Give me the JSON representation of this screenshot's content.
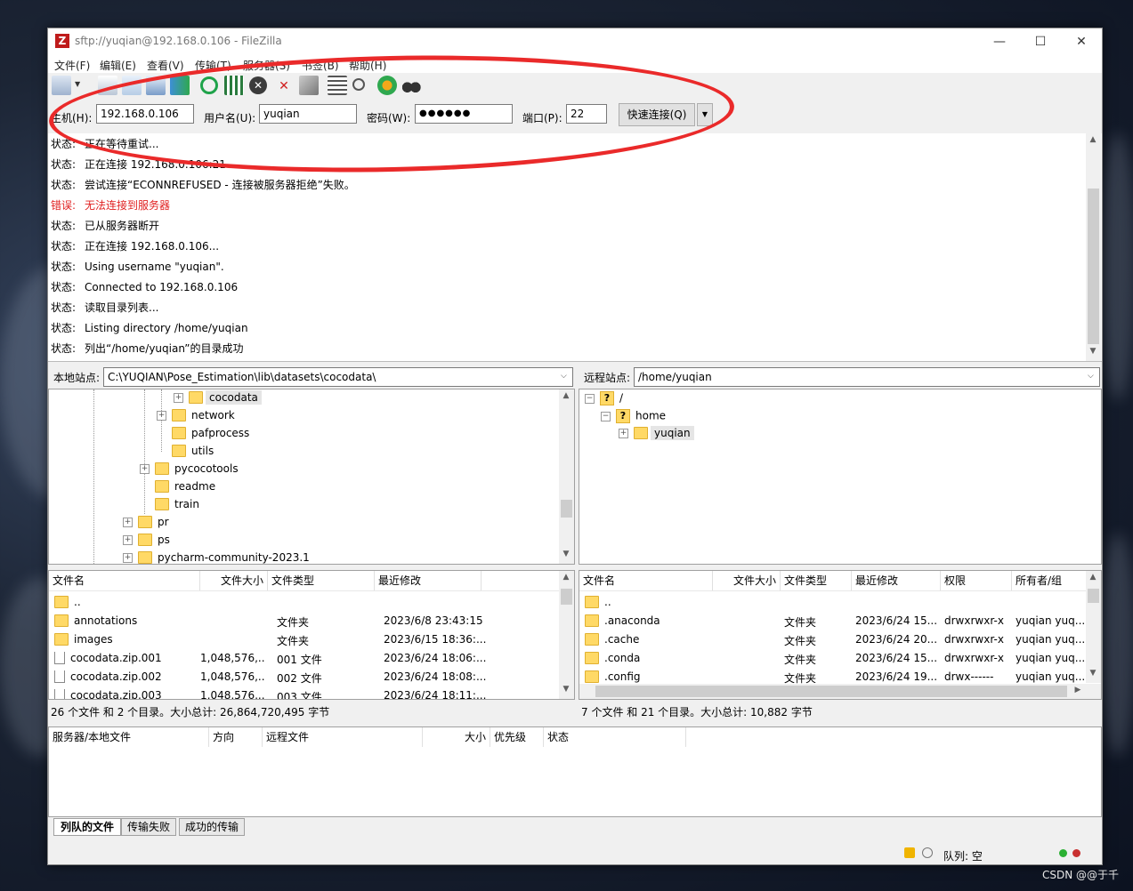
{
  "window": {
    "title": "sftp://yuqian@192.168.0.106 - FileZilla",
    "app_icon_glyph": "Z",
    "min_glyph": "—",
    "max_glyph": "☐",
    "close_glyph": "✕"
  },
  "menu": [
    "文件(F)",
    "编辑(E)",
    "查看(V)",
    "传输(T)",
    "服务器(S)",
    "书签(B)",
    "帮助(H)"
  ],
  "quickconnect": {
    "host_label": "主机(H):",
    "host_value": "192.168.0.106",
    "user_label": "用户名(U):",
    "user_value": "yuqian",
    "pass_label": "密码(W):",
    "pass_value": "●●●●●●",
    "port_label": "端口(P):",
    "port_value": "22",
    "connect_label": "快速连接(Q)",
    "dropdown_glyph": "▼"
  },
  "log": [
    {
      "label": "状态:",
      "text": "正在等待重试...",
      "level": "status"
    },
    {
      "label": "状态:",
      "text": "正在连接 192.168.0.106:21",
      "level": "status"
    },
    {
      "label": "状态:",
      "text": "尝试连接“ECONNREFUSED - 连接被服务器拒绝”失败。",
      "level": "status"
    },
    {
      "label": "错误:",
      "text": "无法连接到服务器",
      "level": "error"
    },
    {
      "label": "状态:",
      "text": "已从服务器断开",
      "level": "status"
    },
    {
      "label": "状态:",
      "text": "正在连接 192.168.0.106...",
      "level": "status"
    },
    {
      "label": "状态:",
      "text": "Using username \"yuqian\".",
      "level": "status"
    },
    {
      "label": "状态:",
      "text": "Connected to 192.168.0.106",
      "level": "status"
    },
    {
      "label": "状态:",
      "text": "读取目录列表...",
      "level": "status"
    },
    {
      "label": "状态:",
      "text": "Listing directory /home/yuqian",
      "level": "status"
    },
    {
      "label": "状态:",
      "text": "列出“/home/yuqian”的目录成功",
      "level": "status"
    }
  ],
  "local": {
    "site_label": "本地站点:",
    "path": "C:\\YUQIAN\\Pose_Estimation\\lib\\datasets\\cocodata\\",
    "tree": [
      {
        "name": "cocodata",
        "expander": "+",
        "selected": true
      },
      {
        "name": "network",
        "expander": "+"
      },
      {
        "name": "pafprocess",
        "expander": ""
      },
      {
        "name": "utils",
        "expander": ""
      },
      {
        "name": "pycocotools",
        "expander": "+"
      },
      {
        "name": "readme",
        "expander": ""
      },
      {
        "name": "train",
        "expander": ""
      },
      {
        "name": "pr",
        "expander": "+"
      },
      {
        "name": "ps",
        "expander": "+"
      },
      {
        "name": "pycharm-community-2023.1",
        "expander": "+"
      }
    ],
    "columns": [
      "文件名",
      "文件大小",
      "文件类型",
      "最近修改"
    ],
    "files": [
      {
        "name": "..",
        "size": "",
        "type": "",
        "modified": "",
        "kind": "folder"
      },
      {
        "name": "annotations",
        "size": "",
        "type": "文件夹",
        "modified": "2023/6/8 23:43:15",
        "kind": "folder"
      },
      {
        "name": "images",
        "size": "",
        "type": "文件夹",
        "modified": "2023/6/15 18:36:...",
        "kind": "folder"
      },
      {
        "name": "cocodata.zip.001",
        "size": "1,048,576,...",
        "type": "001 文件",
        "modified": "2023/6/24 18:06:...",
        "kind": "file"
      },
      {
        "name": "cocodata.zip.002",
        "size": "1,048,576,...",
        "type": "002 文件",
        "modified": "2023/6/24 18:08:...",
        "kind": "file"
      },
      {
        "name": "cocodata.zip.003",
        "size": "1,048,576,...",
        "type": "003 文件",
        "modified": "2023/6/24 18:11:...",
        "kind": "file"
      }
    ],
    "summary": "26 个文件 和 2 个目录。大小总计: 26,864,720,495 字节"
  },
  "remote": {
    "site_label": "远程站点:",
    "path": "/home/yuqian",
    "tree": [
      {
        "name": "/",
        "expander": "−"
      },
      {
        "name": "home",
        "expander": "−"
      },
      {
        "name": "yuqian",
        "expander": "+",
        "selected": true
      }
    ],
    "columns": [
      "文件名",
      "文件大小",
      "文件类型",
      "最近修改",
      "权限",
      "所有者/组"
    ],
    "files": [
      {
        "name": "..",
        "size": "",
        "type": "",
        "modified": "",
        "perm": "",
        "owner": ""
      },
      {
        "name": ".anaconda",
        "size": "",
        "type": "文件夹",
        "modified": "2023/6/24 15...",
        "perm": "drwxrwxr-x",
        "owner": "yuqian yuq..."
      },
      {
        "name": ".cache",
        "size": "",
        "type": "文件夹",
        "modified": "2023/6/24 20...",
        "perm": "drwxrwxr-x",
        "owner": "yuqian yuq..."
      },
      {
        "name": ".conda",
        "size": "",
        "type": "文件夹",
        "modified": "2023/6/24 15...",
        "perm": "drwxrwxr-x",
        "owner": "yuqian yuq..."
      },
      {
        "name": ".config",
        "size": "",
        "type": "文件夹",
        "modified": "2023/6/24 19...",
        "perm": "drwx------",
        "owner": "yuqian yuq..."
      }
    ],
    "summary": "7 个文件 和 21 个目录。大小总计: 10,882 字节"
  },
  "queue": {
    "columns": [
      "服务器/本地文件",
      "方向",
      "远程文件",
      "大小",
      "优先级",
      "状态"
    ],
    "tabs": [
      "列队的文件",
      "传输失败",
      "成功的传输"
    ],
    "status": "队列: 空"
  },
  "watermark": "CSDN @@于千",
  "colors": {
    "annotation_ellipse": "#ea2a2a",
    "error_text": "#e02020",
    "folder": "#ffd966"
  }
}
